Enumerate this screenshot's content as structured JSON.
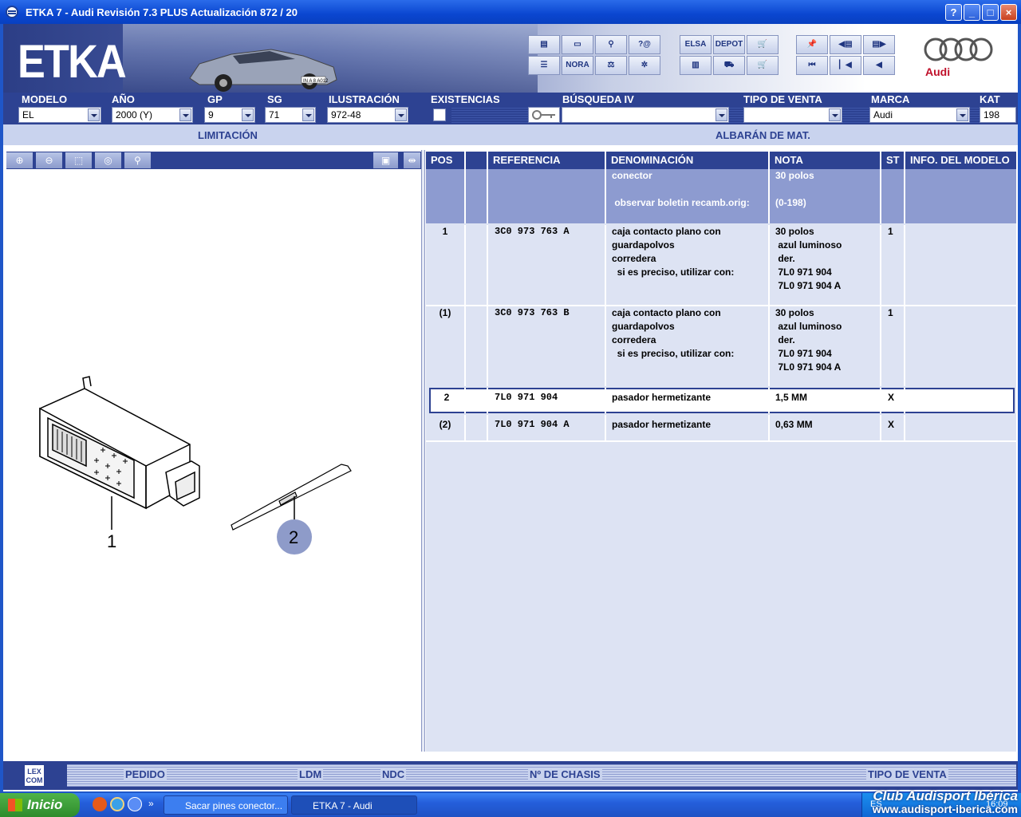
{
  "window": {
    "title": "ETKA 7 - Audi Revisión 7.3 PLUS Actualización 872 / 20",
    "buttons": [
      "?",
      "_",
      "□",
      "×"
    ]
  },
  "banner": {
    "logo": "ETKA",
    "plate": "IN A 8 A012",
    "toolbar_icons": [
      {
        "name": "print-icon",
        "label": ""
      },
      {
        "name": "frame-icon",
        "label": ""
      },
      {
        "name": "binoculars-icon",
        "label": ""
      },
      {
        "name": "help-at-icon",
        "label": "?@"
      },
      {
        "name": "list-icon",
        "label": ""
      },
      {
        "name": "nora-icon",
        "label": "NORA"
      },
      {
        "name": "scale-icon",
        "label": ""
      },
      {
        "name": "wheel-icon",
        "label": ""
      },
      {
        "name": "elsa-icon",
        "label": "ELSA"
      },
      {
        "name": "depot-icon",
        "label": "DEPOT"
      },
      {
        "name": "cart-icon",
        "label": ""
      },
      {
        "name": "pin-icon",
        "label": ""
      },
      {
        "name": "prev-page-icon",
        "label": ""
      },
      {
        "name": "next-page-icon",
        "label": ""
      },
      {
        "name": "first-icon",
        "label": ""
      },
      {
        "name": "back-icon",
        "label": ""
      },
      {
        "name": "left-icon",
        "label": ""
      }
    ],
    "brand": "Audi"
  },
  "filters": {
    "modelo": {
      "label": "MODELO",
      "value": "EL"
    },
    "anio": {
      "label": "AÑO",
      "value": "2000 (Y)"
    },
    "gp": {
      "label": "GP",
      "value": "9"
    },
    "sg": {
      "label": "SG",
      "value": "71"
    },
    "ilustracion": {
      "label": "ILUSTRACIÓN",
      "value": "972-48"
    },
    "existencias": {
      "label": "EXISTENCIAS"
    },
    "busqueda": {
      "label": "BÚSQUEDA IV",
      "value": ""
    },
    "tipo_venta": {
      "label": "TIPO DE VENTA",
      "value": ""
    },
    "marca": {
      "label": "MARCA",
      "value": "Audi"
    },
    "kat": {
      "label": "KAT",
      "value": "198"
    }
  },
  "subheader": {
    "limitacion": "LIMITACIÓN",
    "albaran": "ALBARÁN DE MAT."
  },
  "zoom_tools": [
    "zoom-in-icon",
    "zoom-out-icon",
    "zoom-area-icon",
    "zoom-100-icon",
    "search-icon"
  ],
  "drawing": {
    "callout_1": "1",
    "callout_2": "2"
  },
  "table": {
    "columns": [
      "POS",
      "",
      "REFERENCIA",
      "DENOMINACIÓN",
      "NOTA",
      "ST",
      "INFO. DEL MODELO"
    ],
    "rows": [
      {
        "pos": "",
        "ref": "",
        "den": "conector\n\n observar boletin recamb.orig:",
        "nota": "30 polos\n\n(0-198)",
        "st": "",
        "info": ""
      },
      {
        "pos": "1",
        "ref": "3C0 973 763 A",
        "den": "caja contacto plano con\nguardapolvos\ncorredera\n  si es preciso, utilizar con:",
        "nota": "30 polos\n azul luminoso\n der.\n 7L0 971 904\n 7L0 971 904 A",
        "st": "1",
        "info": ""
      },
      {
        "pos": "(1)",
        "ref": "3C0 973 763 B",
        "den": "caja contacto plano con\nguardapolvos\ncorredera\n  si es preciso, utilizar con:",
        "nota": "30 polos\n azul luminoso\n der.\n 7L0 971 904\n 7L0 971 904 A",
        "st": "1",
        "info": ""
      },
      {
        "pos": "2",
        "ref": "7L0 971 904",
        "den": "pasador hermetizante",
        "nota": "1,5 MM",
        "st": "X",
        "info": ""
      },
      {
        "pos": "(2)",
        "ref": "7L0 971 904 A",
        "den": "pasador hermetizante",
        "nota": "0,63 MM",
        "st": "X",
        "info": ""
      }
    ]
  },
  "bottom": {
    "lexcom": "LEX\nCOM",
    "pedido": "PEDIDO",
    "ldm": "LDM",
    "ndc": "NDC",
    "chasis": "Nº DE CHASIS",
    "tipo_venta": "TIPO DE VENTA"
  },
  "taskbar": {
    "start": "Inicio",
    "items": [
      "Sacar pines conector...",
      "ETKA 7 - Audi"
    ],
    "lang": "ES",
    "clock": "16:09",
    "watermark_1": "Club Audisport Ibérica",
    "watermark_2": "www.audisport-iberica.com"
  }
}
